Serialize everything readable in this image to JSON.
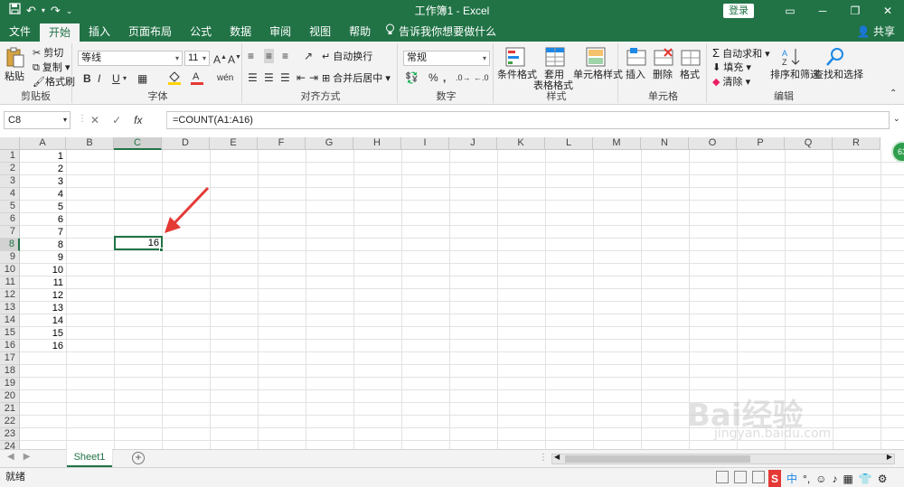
{
  "window": {
    "title": "工作簿1  -  Excel",
    "login_label": "登录",
    "ctrl_icons": [
      "▭",
      "─",
      "❐",
      "✕"
    ]
  },
  "qat": {
    "save_icon": "save-icon",
    "undo_icon": "undo-icon",
    "redo_icon": "redo-icon"
  },
  "tabs": [
    "文件",
    "开始",
    "插入",
    "页面布局",
    "公式",
    "数据",
    "审阅",
    "视图",
    "帮助"
  ],
  "tell_me": "告诉我你想要做什么",
  "share": "共享",
  "ribbon": {
    "clipboard": {
      "label": "剪贴板",
      "paste": "粘贴",
      "cut": "剪切",
      "copy": "复制",
      "format_painter": "格式刷"
    },
    "font": {
      "label": "字体",
      "font_name": "等线",
      "font_size": "11",
      "bold": "B",
      "italic": "I",
      "underline": "U"
    },
    "alignment": {
      "label": "对齐方式",
      "wrap": "自动换行",
      "merge": "合并后居中"
    },
    "number": {
      "label": "数字",
      "format": "常规",
      "percent": "%",
      "comma": ","
    },
    "styles": {
      "label": "样式",
      "conditional": "条件格式",
      "table_format_1": "套用",
      "table_format_2": "表格格式",
      "cell_styles": "单元格样式"
    },
    "cells": {
      "label": "单元格",
      "insert": "插入",
      "delete": "删除",
      "format": "格式"
    },
    "editing": {
      "label": "编辑",
      "autosum": "自动求和",
      "fill": "填充",
      "clear": "清除",
      "sort_filter": "排序和筛选",
      "find_select": "查找和选择"
    }
  },
  "formula_bar": {
    "name_box": "C8",
    "cancel": "✕",
    "enter": "✓",
    "fx": "fx",
    "formula": "=COUNT(A1:A16)"
  },
  "columns": [
    "A",
    "B",
    "C",
    "D",
    "E",
    "F",
    "G",
    "H",
    "I",
    "J",
    "K",
    "L",
    "M",
    "N",
    "O",
    "P",
    "Q",
    "R"
  ],
  "rows": [
    "1",
    "2",
    "3",
    "4",
    "5",
    "6",
    "7",
    "8",
    "9",
    "10",
    "11",
    "12",
    "13",
    "14",
    "15",
    "16",
    "17",
    "18",
    "19",
    "20",
    "21",
    "22",
    "23",
    "24"
  ],
  "column_a_values": [
    "1",
    "2",
    "3",
    "4",
    "5",
    "6",
    "7",
    "8",
    "9",
    "10",
    "11",
    "12",
    "13",
    "14",
    "15",
    "16"
  ],
  "active_cell": {
    "ref": "C8",
    "value": "16"
  },
  "badge": "63",
  "sheets": [
    {
      "name": "Sheet1",
      "active": true
    }
  ],
  "status": {
    "ready": "就绪"
  },
  "tray": [
    "S",
    "中",
    "°,",
    "☺",
    "♪",
    "▦",
    "👕",
    "⚙"
  ],
  "watermark": {
    "main": "Bai经验",
    "sub": "jingyan.baidu.com"
  },
  "colors": {
    "accent": "#217346",
    "arrow": "#e53935"
  }
}
